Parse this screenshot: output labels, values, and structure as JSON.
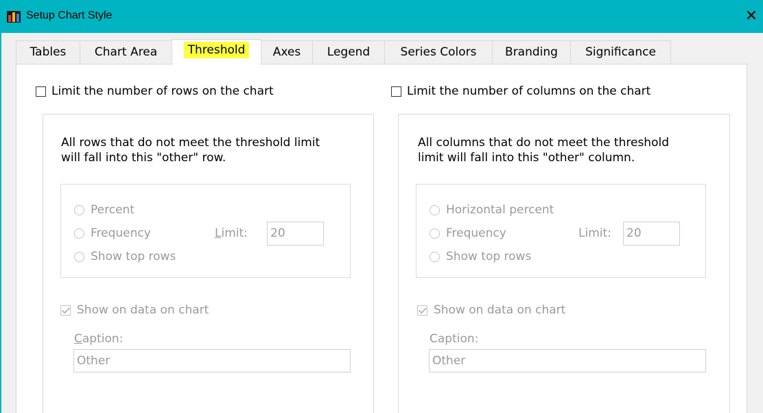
{
  "window": {
    "title": "Setup Chart Style"
  },
  "tabs": [
    {
      "label": "Tables"
    },
    {
      "label": "Chart Area"
    },
    {
      "label": "Threshold"
    },
    {
      "label": "Axes"
    },
    {
      "label": "Legend"
    },
    {
      "label": "Series Colors"
    },
    {
      "label": "Branding"
    },
    {
      "label": "Significance"
    }
  ],
  "active_tab": "Threshold",
  "rows": {
    "limit_checkbox_label": "Limit the number of rows on the chart",
    "limit_checked": false,
    "description_line1": "All rows that do not meet the threshold limit",
    "description_line2": "will fall into this \"other\" row.",
    "options": [
      {
        "label": "Percent"
      },
      {
        "label": "Frequency"
      },
      {
        "label": "Show top rows"
      }
    ],
    "limit_label_first": "L",
    "limit_label_rest": "imit:",
    "limit_value": "20",
    "show_data_label": "Show on data on chart",
    "show_data_checked": true,
    "caption_label_first": "C",
    "caption_label_rest": "aption:",
    "caption_value": "Other"
  },
  "columns": {
    "limit_checkbox_label": "Limit the number of columns on the chart",
    "limit_checked": false,
    "description_line1": "All columns that do not meet the threshold",
    "description_line2": "limit will fall into this \"other\" column.",
    "options": [
      {
        "label": "Horizontal percent"
      },
      {
        "label": "Frequency"
      },
      {
        "label": "Show top rows"
      }
    ],
    "limit_label": "Limit:",
    "limit_value": "20",
    "show_data_label": "Show on data on chart",
    "show_data_checked": true,
    "caption_label": "Caption:",
    "caption_value": "Other"
  },
  "colors": {
    "titlebar": "#00b4c2",
    "active_tab_highlight": "#ffff40",
    "disabled_text": "#9a9a9a"
  },
  "icons": {
    "app": "bar-chart-icon",
    "close": "close-icon"
  }
}
